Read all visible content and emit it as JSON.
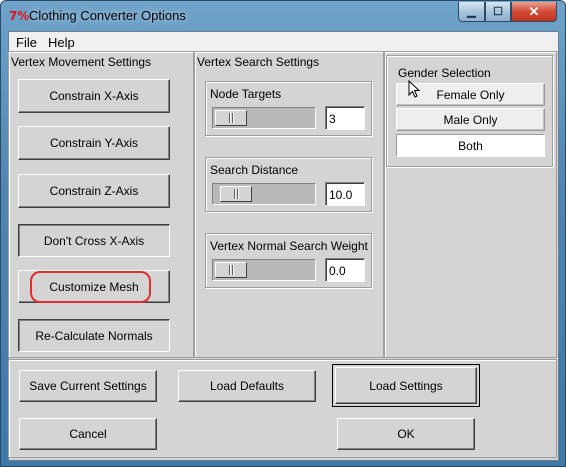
{
  "window": {
    "title": "Clothing Converter Options",
    "app_icon_glyph": "7%",
    "controls": {
      "minimize": "▁",
      "maximize": "☐",
      "close": "✕"
    }
  },
  "menu": {
    "file": "File",
    "help": "Help"
  },
  "vertex_movement": {
    "title": "Vertex Movement Settings",
    "buttons": {
      "constrain_x": "Constrain X-Axis",
      "constrain_y": "Constrain Y-Axis",
      "constrain_z": "Constrain Z-Axis",
      "dont_cross_x": "Don't Cross X-Axis",
      "customize_mesh": "Customize Mesh",
      "recalc_normals": "Re-Calculate Normals"
    }
  },
  "vertex_search": {
    "title": "Vertex Search Settings",
    "node_targets": {
      "label": "Node Targets",
      "value": "3",
      "slider_level": 0.0
    },
    "search_distance": {
      "label": "Search Distance",
      "value": "10.0",
      "slider_level": 0.08
    },
    "normal_weight": {
      "label": "Vertex Normal Search Weight",
      "value": "0.0",
      "slider_level": 0.0
    }
  },
  "gender": {
    "title": "Gender Selection",
    "options": [
      "Female Only",
      "Male Only",
      "Both"
    ],
    "selected": "Both"
  },
  "bottom": {
    "save": "Save Current Settings",
    "load_defaults": "Load Defaults",
    "load_settings": "Load Settings",
    "cancel": "Cancel",
    "ok": "OK"
  },
  "colors": {
    "highlight_ring": "#e02d2d",
    "title_icon": "#dd1111",
    "close_button": "#c23421"
  }
}
